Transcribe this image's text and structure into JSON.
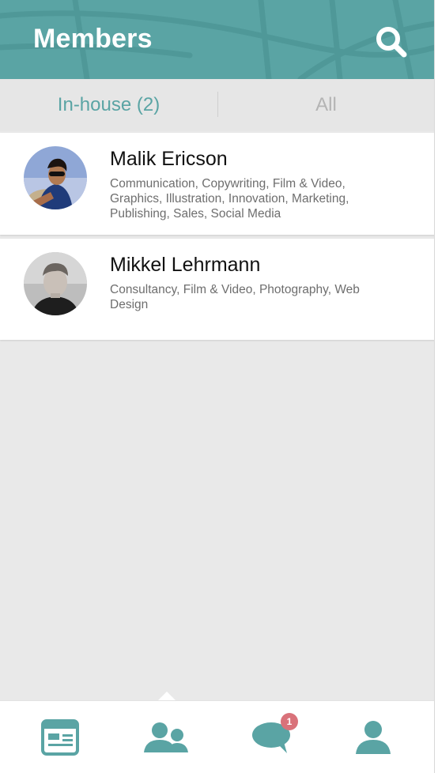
{
  "header": {
    "title": "Members",
    "search_icon": "search-icon",
    "color": "#5aa4a4"
  },
  "tabs": [
    {
      "label": "In-house (2)",
      "active": true
    },
    {
      "label": "All",
      "active": false
    }
  ],
  "members": [
    {
      "name": "Malik Ericson",
      "skills": "Communication, Copywriting, Film & Video, Graphics, Illustration, Innovation, Marketing, Publishing, Sales, Social Media",
      "avatar_icon": "avatar-photo"
    },
    {
      "name": "Mikkel Lehrmann",
      "skills": "Consultancy, Film & Video, Photography, Web Design",
      "avatar_icon": "avatar-photo"
    }
  ],
  "bottom_nav": {
    "items": [
      {
        "icon": "feed-icon",
        "active": false
      },
      {
        "icon": "members-icon",
        "active": true
      },
      {
        "icon": "messages-icon",
        "active": false,
        "badge": "1"
      },
      {
        "icon": "profile-icon",
        "active": false
      }
    ],
    "accent": "#5aa4a4",
    "badge_color": "#d9727a"
  }
}
